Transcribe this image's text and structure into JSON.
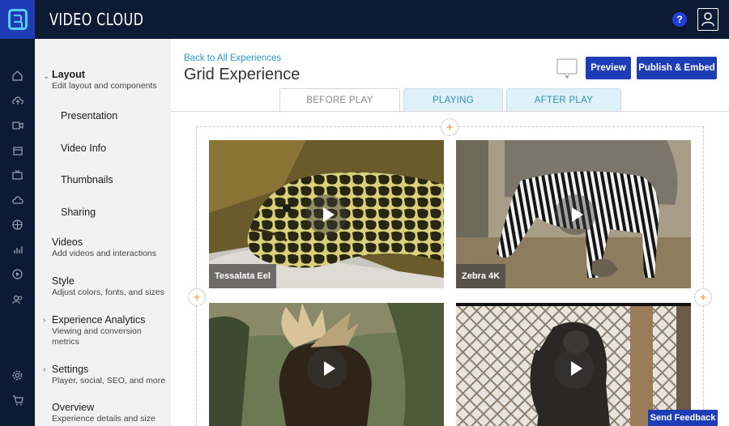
{
  "app": {
    "brand": "VIDEO CLOUD",
    "help_label": "?"
  },
  "sidebar": {
    "sections": [
      {
        "title": "Layout",
        "subtitle": "Edit layout and components",
        "expanded": true
      },
      {
        "title": "Videos",
        "subtitle": "Add videos and interactions"
      },
      {
        "title": "Style",
        "subtitle": "Adjust colors, fonts, and sizes"
      },
      {
        "title": "Experience Analytics",
        "subtitle": "Viewing and conversion metrics"
      },
      {
        "title": "Settings",
        "subtitle": "Player, social, SEO, and more"
      },
      {
        "title": "Overview",
        "subtitle": "Experience details and size"
      }
    ],
    "layout_items": [
      "Presentation",
      "Video Info",
      "Thumbnails",
      "Sharing"
    ]
  },
  "header": {
    "back_link": "Back to All Experiences",
    "title": "Grid Experience",
    "preview_label": "Preview",
    "publish_label": "Publish & Embed"
  },
  "tabs": [
    {
      "label": "BEFORE PLAY",
      "active": true
    },
    {
      "label": "PLAYING",
      "active": false
    },
    {
      "label": "AFTER PLAY",
      "active": false
    }
  ],
  "videos": [
    {
      "title": "Tessalata Eel"
    },
    {
      "title": "Zebra 4K"
    },
    {
      "title": ""
    },
    {
      "title": ""
    }
  ],
  "feedback_label": "Send Feedback",
  "colors": {
    "nav_bg": "#0d1a33",
    "brand_blue": "#1f3cb7",
    "link": "#2a9bc9",
    "accent_orange": "#e8902a",
    "tab_bg": "#dff1f8"
  }
}
